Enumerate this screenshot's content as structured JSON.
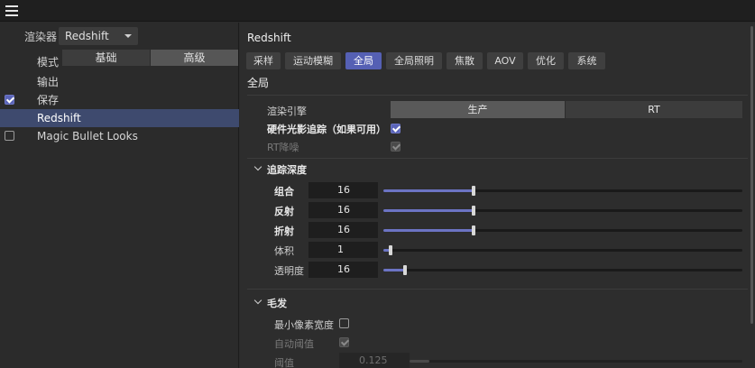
{
  "left": {
    "renderer_label": "渲染器",
    "renderer_value": "Redshift",
    "mode_label": "模式",
    "mode_basic": "基础",
    "mode_advanced": "高级",
    "items": [
      {
        "label": "输出",
        "check": "none"
      },
      {
        "label": "保存",
        "check": "on"
      },
      {
        "label": "Redshift",
        "check": "none",
        "selected": true
      },
      {
        "label": "Magic Bullet Looks",
        "check": "off"
      }
    ]
  },
  "right": {
    "title": "Redshift",
    "tabs": [
      "采样",
      "运动模糊",
      "全局",
      "全局照明",
      "焦散",
      "AOV",
      "优化",
      "系统"
    ],
    "active_tab": "全局",
    "section": "全局",
    "engine_label": "渲染引擎",
    "engine_options": [
      "生产",
      "RT"
    ],
    "engine_selected": "生产",
    "hw_rt_label": "硬件光影追踪（如果可用）",
    "rt_denoise_label": "RT降噪",
    "trace_group": "追踪深度",
    "trace": [
      {
        "label": "组合",
        "value": "16",
        "fraction": 0.25
      },
      {
        "label": "反射",
        "value": "16",
        "fraction": 0.25
      },
      {
        "label": "折射",
        "value": "16",
        "fraction": 0.25
      },
      {
        "label": "体积",
        "value": "1",
        "fraction": 0.02
      },
      {
        "label": "透明度",
        "value": "16",
        "fraction": 0.06
      }
    ],
    "hair_group": "毛发",
    "min_pixel_width_label": "最小像素宽度",
    "auto_threshold_label": "自动阈值",
    "threshold_label": "阈值",
    "threshold_value": "0.125",
    "threshold_fraction": 0.06
  },
  "colors": {
    "accent": "#5560b4",
    "selected_row": "#3e4a6e"
  }
}
